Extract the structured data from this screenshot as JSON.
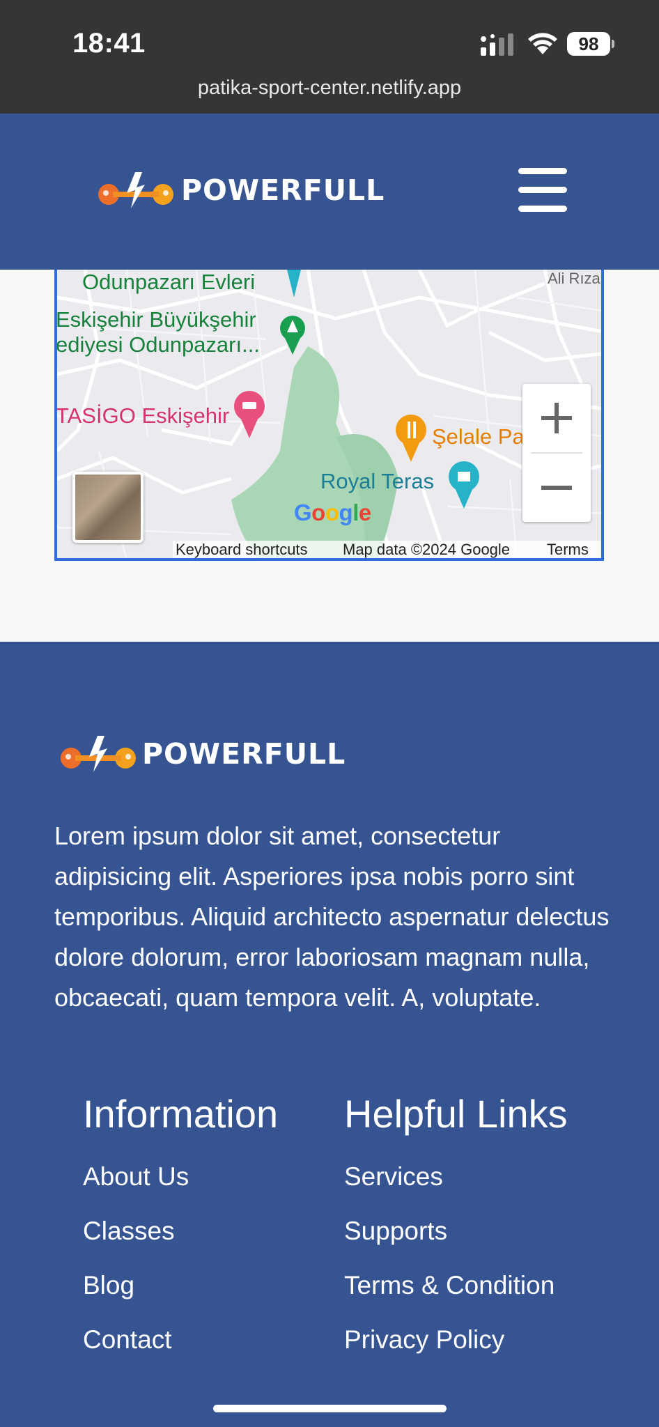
{
  "status_bar": {
    "time": "18:41",
    "battery": "98"
  },
  "browser": {
    "url": "patika-sport-center.netlify.app"
  },
  "header": {
    "brand": "POWERFULL"
  },
  "map": {
    "labels": {
      "odunpazari_evleri": "Odunpazarı Evleri",
      "ali_riza": "Ali Rıza",
      "buyuksehir_1": "Eskişehir Büyükşehir",
      "buyuksehir_2": "ediyesi Odunpazarı...",
      "tasigo": "TASİGO Eskişehir",
      "selale": "Şelale Pa",
      "royal_teras": "Royal Teras"
    },
    "google_logo": "Google",
    "attribution": {
      "keyboard_shortcuts": "Keyboard shortcuts",
      "map_data": "Map data ©2024 Google",
      "terms": "Terms"
    }
  },
  "footer": {
    "brand": "POWERFULL",
    "about": "Lorem ipsum dolor sit amet, consectetur adipisicing elit. Asperiores ipsa nobis porro sint temporibus. Aliquid architecto aspernatur delectus dolore dolorum, error laboriosam magnam nulla, obcaecati, quam tempora velit. A, voluptate.",
    "information": {
      "title": "Information",
      "links": [
        "About Us",
        "Classes",
        "Blog",
        "Contact"
      ]
    },
    "helpful_links": {
      "title": "Helpful Links",
      "links": [
        "Services",
        "Supports",
        "Terms & Condition",
        "Privacy Policy"
      ]
    }
  },
  "colors": {
    "brand_blue": "#355491",
    "logo_orange": "#f39a1e",
    "map_border": "#2f6fdc"
  }
}
